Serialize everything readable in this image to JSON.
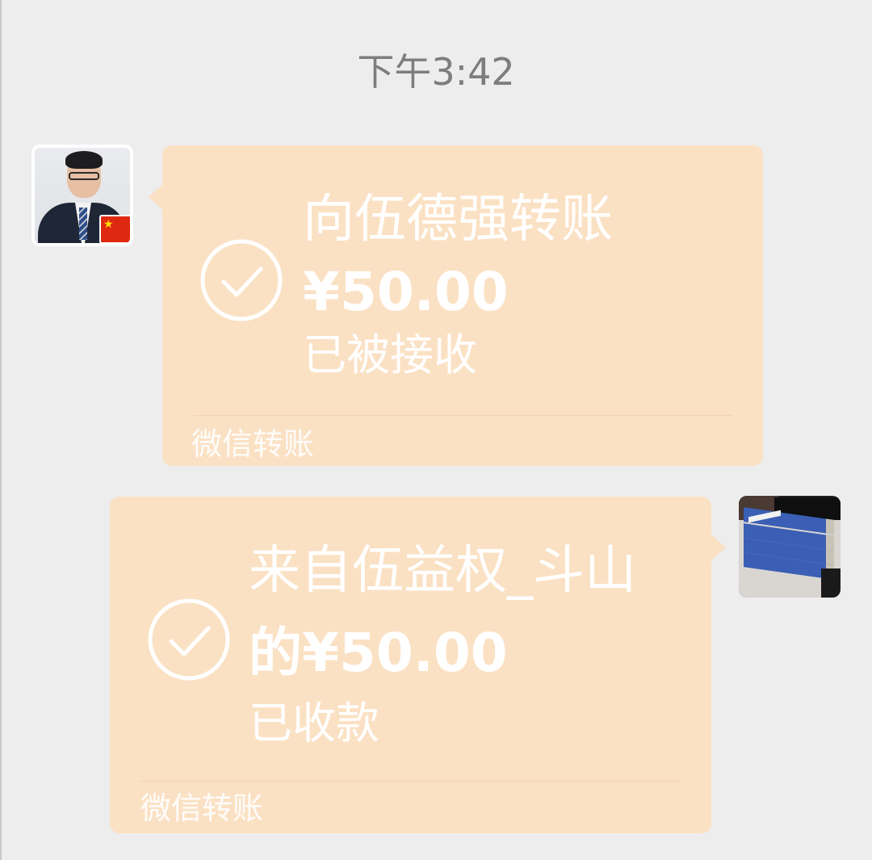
{
  "timestamp": "下午3:42",
  "messages": [
    {
      "direction": "received",
      "title": "向伍德强转账",
      "amount": "¥50.00",
      "status": "已被接收",
      "footer": "微信转账",
      "avatar_icon": "profile-photo-man-in-suit-with-china-flag"
    },
    {
      "direction": "sent",
      "title_line1": "来自伍益权_斗山",
      "title_line2": "的¥50.00",
      "status": "已收款",
      "footer": "微信转账",
      "avatar_icon": "profile-photo-stack-of-blue-books"
    }
  ],
  "colors": {
    "background": "#ededed",
    "bubble": "#fbe1c4",
    "bubble_text": "#ffffff",
    "timestamp": "#7d7d7d"
  },
  "icons": {
    "status": "check-circle-icon"
  }
}
